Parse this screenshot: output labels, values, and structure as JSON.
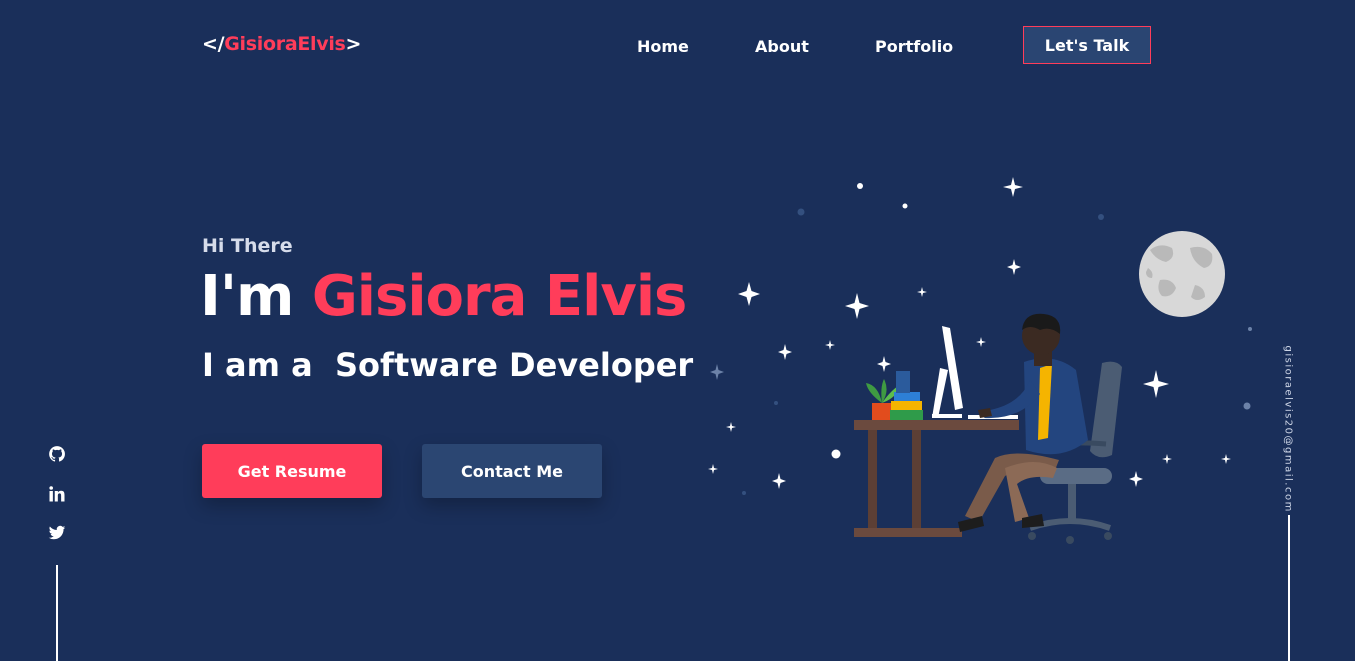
{
  "logo": {
    "open": "</",
    "name": "GisioraElvis",
    "close": ">"
  },
  "nav": {
    "links": [
      "Home",
      "About",
      "Portfolio"
    ],
    "cta": "Let's Talk"
  },
  "hero": {
    "greeting": "Hi There",
    "intro": "I'm ",
    "name": "Gisiora Elvis",
    "role": "I am a  Software Developer",
    "primary_button": "Get Resume",
    "secondary_button": "Contact Me"
  },
  "social": [
    "github-icon",
    "linkedin-icon",
    "twitter-icon"
  ],
  "email": "gisioraelvis20@gmail.com",
  "colors": {
    "background": "#1a2f5a",
    "accent": "#ff3d5a",
    "secondary": "#2b4672"
  }
}
